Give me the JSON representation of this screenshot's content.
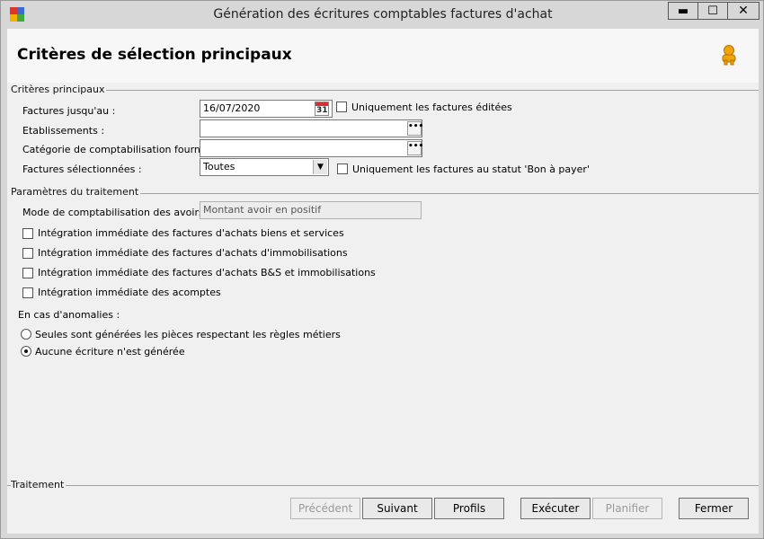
{
  "window": {
    "title": "Génération des écritures comptables factures d'achat",
    "controls": {
      "minimize": "▬",
      "maximize": "☐",
      "close": "✕"
    }
  },
  "header": {
    "title": "Critères de sélection principaux",
    "icon": "user-icon"
  },
  "group_main": {
    "title": "Critères principaux",
    "factures_label": "Factures jusqu'au :",
    "factures_value": "16/07/2020",
    "calendar_day": "31",
    "uniquement_editees": "Uniquement les factures éditées",
    "etablissements_label": "Etablissements :",
    "etablissements_value": "",
    "categorie_label": "Catégorie de comptabilisation fourn. :",
    "categorie_value": "",
    "dots": "•••",
    "selectionnees_label": "Factures sélectionnées :",
    "selectionnees_value": "Toutes",
    "uniquement_statut": "Uniquement les factures au statut 'Bon à payer'"
  },
  "group_traitement": {
    "title": "Paramètres du traitement",
    "mode_label": "Mode de comptabilisation des avoirs :",
    "mode_value": "Montant avoir en positif",
    "options": [
      "Intégration immédiate des factures d'achats biens et services",
      "Intégration immédiate des factures d'achats d'immobilisations",
      "Intégration immédiate des factures d'achats B&S et immobilisations",
      "Intégration immédiate des acomptes"
    ],
    "anomalies_label": "En cas d'anomalies :",
    "radio_1": "Seules sont générées les pièces respectant les règles métiers",
    "radio_2": "Aucune écriture n'est générée",
    "selected_radio": 2
  },
  "footer": {
    "title": "Traitement",
    "buttons": {
      "precedent": "Précédent",
      "suivant": "Suivant",
      "profils": "Profils",
      "executer": "Exécuter",
      "planifier": "Planifier",
      "fermer": "Fermer"
    }
  },
  "colors": {
    "background": "#f0f0f0",
    "titlebar": "#d7d7d7",
    "user_icon": "#f0a30a"
  }
}
